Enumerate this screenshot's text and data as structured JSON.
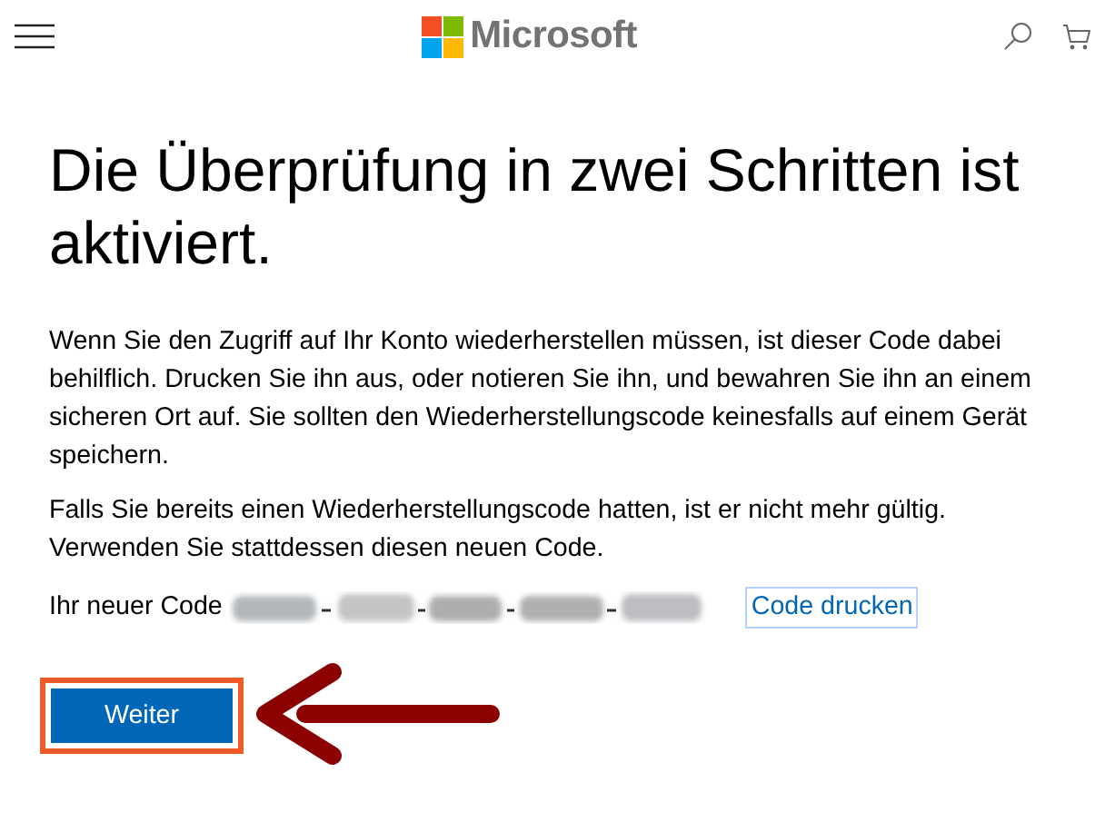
{
  "header": {
    "brand": "Microsoft"
  },
  "heading": "Die Überprüfung in zwei Schritten ist aktiviert.",
  "paragraphs": [
    "Wenn Sie den Zugriff auf Ihr Konto wiederherstellen müssen, ist dieser Code dabei behilflich. Drucken Sie ihn aus, oder notieren Sie ihn, und bewahren Sie ihn an einem sicheren Ort auf. Sie sollten den Wiederherstellungscode keinesfalls auf einem Gerät speichern.",
    "Falls Sie bereits einen Wiederherstellungscode hatten, ist er nicht mehr gültig. Verwenden Sie stattdessen diesen neuen Code."
  ],
  "code_row": {
    "label": "Ihr neuer Code",
    "print_link": "Code drucken"
  },
  "primary_button": {
    "label": "Weiter",
    "highlighted": true
  }
}
